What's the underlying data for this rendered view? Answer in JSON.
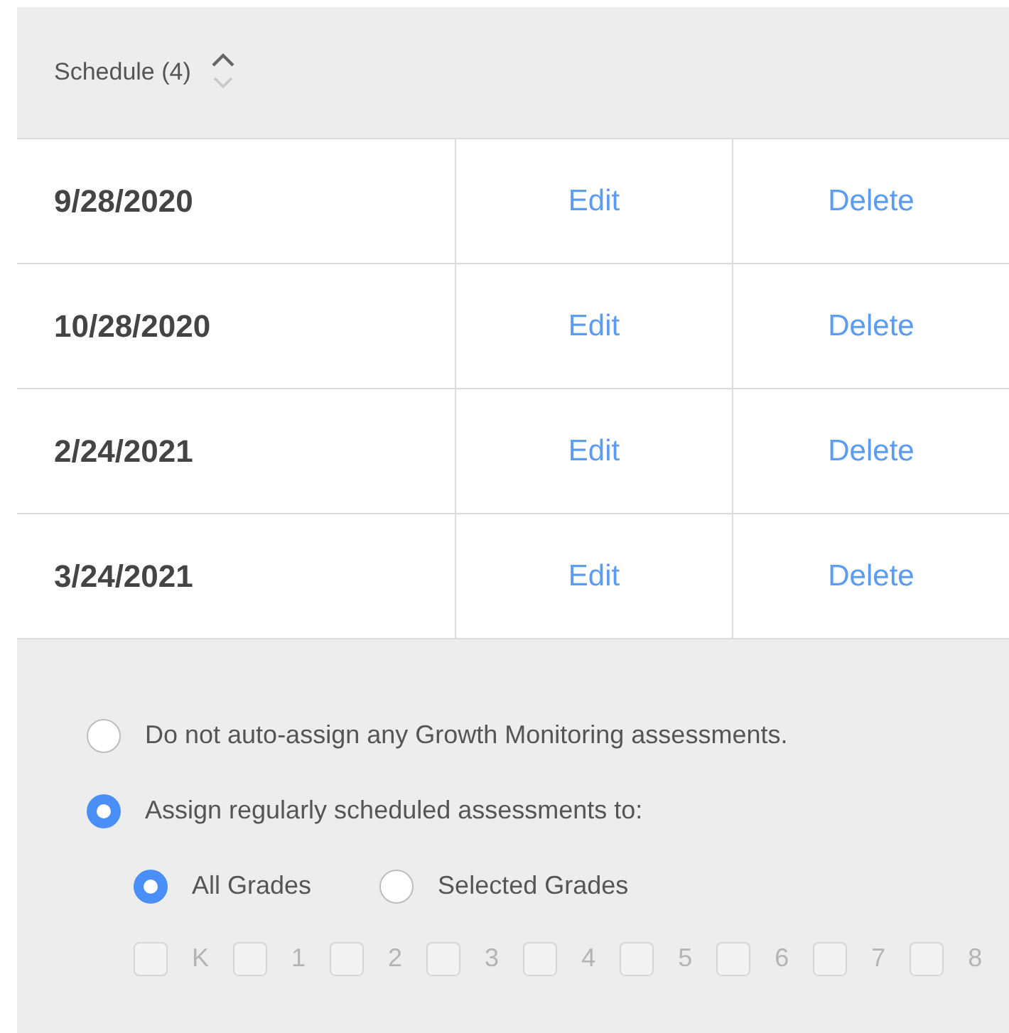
{
  "table": {
    "header": {
      "label": "Schedule (4)",
      "sorted_ascending": true
    },
    "rows": [
      {
        "date": "9/28/2020",
        "edit": "Edit",
        "delete": "Delete"
      },
      {
        "date": "10/28/2020",
        "edit": "Edit",
        "delete": "Delete"
      },
      {
        "date": "2/24/2021",
        "edit": "Edit",
        "delete": "Delete"
      },
      {
        "date": "3/24/2021",
        "edit": "Edit",
        "delete": "Delete"
      }
    ]
  },
  "assign_options": [
    {
      "label": "Do not auto-assign any Growth Monitoring assessments.",
      "selected": false
    },
    {
      "label": "Assign regularly scheduled assessments to:",
      "selected": true
    }
  ],
  "grade_scope": [
    {
      "label": "All Grades",
      "selected": true
    },
    {
      "label": "Selected Grades",
      "selected": false
    }
  ],
  "grades": [
    {
      "label": "K",
      "checked": false,
      "disabled": true
    },
    {
      "label": "1",
      "checked": false,
      "disabled": true
    },
    {
      "label": "2",
      "checked": false,
      "disabled": true
    },
    {
      "label": "3",
      "checked": false,
      "disabled": true
    },
    {
      "label": "4",
      "checked": false,
      "disabled": true
    },
    {
      "label": "5",
      "checked": false,
      "disabled": true
    },
    {
      "label": "6",
      "checked": false,
      "disabled": true
    },
    {
      "label": "7",
      "checked": false,
      "disabled": true
    },
    {
      "label": "8",
      "checked": false,
      "disabled": true
    }
  ]
}
